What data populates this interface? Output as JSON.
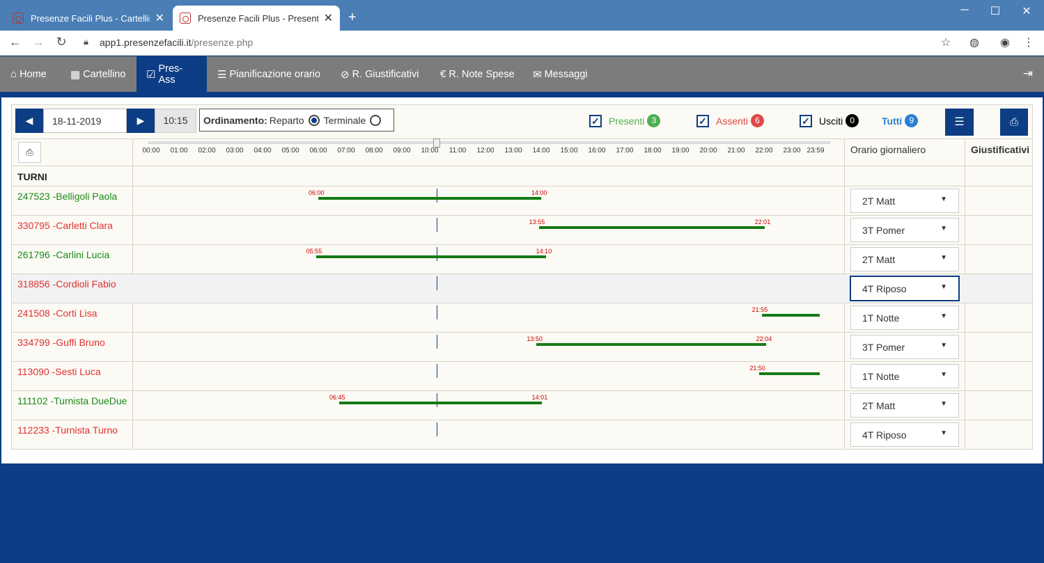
{
  "browser": {
    "tabs": [
      {
        "title": "Presenze Facili Plus - Cartellino",
        "active": false
      },
      {
        "title": "Presenze Facili Plus - Presenti-As",
        "active": true
      }
    ],
    "url_domain": "app1.presenzefacili.it",
    "url_path": "/presenze.php"
  },
  "nav": {
    "items": [
      {
        "label": "Home",
        "icon": "home-icon"
      },
      {
        "label": "Cartellino",
        "icon": "calendar-icon"
      },
      {
        "label": "Pres-Ass",
        "icon": "check-square-icon",
        "active": true
      },
      {
        "label": "Pianificazione orario",
        "icon": "list-icon"
      },
      {
        "label": "R. Giustificativi",
        "icon": "paperclip-icon"
      },
      {
        "label": "R. Note Spese",
        "icon": "euro-icon"
      },
      {
        "label": "Messaggi",
        "icon": "envelope-icon"
      }
    ]
  },
  "toolbar": {
    "date": "18-11-2019",
    "time": "10:15",
    "sort_label": "Ordinamento:",
    "sort_opt1": "Reparto",
    "sort_opt2": "Terminale",
    "filters": [
      {
        "label": "Presenti",
        "count": "3",
        "color": "#4caf50"
      },
      {
        "label": "Assenti",
        "count": "6",
        "color": "#e04848"
      },
      {
        "label": "Usciti",
        "count": "0",
        "color": "#000000"
      },
      {
        "label": "Tutti",
        "count": "9",
        "color": "#2a7fd4"
      }
    ]
  },
  "timeline": {
    "ticks": [
      "00:00",
      "01:00",
      "02:00",
      "03:00",
      "04:00",
      "05:00",
      "06:00",
      "07:00",
      "08:00",
      "09:00",
      "10:00",
      "11:00",
      "12:00",
      "13:00",
      "14:00",
      "15:00",
      "16:00",
      "17:00",
      "18:00",
      "19:00",
      "20:00",
      "21:00",
      "22:00",
      "23:00",
      "23:59"
    ],
    "now_hours": 10.25
  },
  "columns": {
    "schedule": "Orario giornaliero",
    "justifications": "Giustificativi"
  },
  "group": "TURNI",
  "employees": [
    {
      "name": "247523 -Belligoli Paola",
      "status": "present",
      "start": "06:00",
      "end": "14:00",
      "start_h": 6.0,
      "end_h": 14.0,
      "shift": "2T Matt"
    },
    {
      "name": "330795 -Carletti Clara",
      "status": "absent",
      "start": "13:55",
      "end": "22:01",
      "start_h": 13.917,
      "end_h": 22.017,
      "shift": "3T Pomer"
    },
    {
      "name": "261796 -Carlini Lucia",
      "status": "present",
      "start": "05:55",
      "end": "14:10",
      "start_h": 5.917,
      "end_h": 14.167,
      "shift": "2T Matt"
    },
    {
      "name": "318856 -Cordioli Fabio",
      "status": "absent",
      "start": "",
      "end": "",
      "start_h": null,
      "end_h": null,
      "shift": "4T Riposo",
      "focused": true
    },
    {
      "name": "241508 -Corti Lisa",
      "status": "absent",
      "start": "21:55",
      "end": "",
      "start_h": 21.917,
      "end_h": 24.0,
      "shift": "1T Notte"
    },
    {
      "name": "334799 -Guffi Bruno",
      "status": "absent",
      "start": "13:50",
      "end": "22:04",
      "start_h": 13.833,
      "end_h": 22.067,
      "shift": "3T Pomer"
    },
    {
      "name": "113090 -Sesti Luca",
      "status": "absent",
      "start": "21:50",
      "end": "",
      "start_h": 21.833,
      "end_h": 24.0,
      "shift": "1T Notte"
    },
    {
      "name": "111102 -Turnista DueDue",
      "status": "present",
      "start": "06:45",
      "end": "14:01",
      "start_h": 6.75,
      "end_h": 14.017,
      "shift": "2T Matt"
    },
    {
      "name": "112233 -Turnista Turno",
      "status": "absent",
      "start": "",
      "end": "",
      "start_h": null,
      "end_h": null,
      "shift": "4T Riposo"
    }
  ],
  "colors": {
    "brand": "#0d3d84",
    "present": "#1a8a1a",
    "absent": "#e03030",
    "bar": "#157a15",
    "time_label": "#cc0000"
  }
}
